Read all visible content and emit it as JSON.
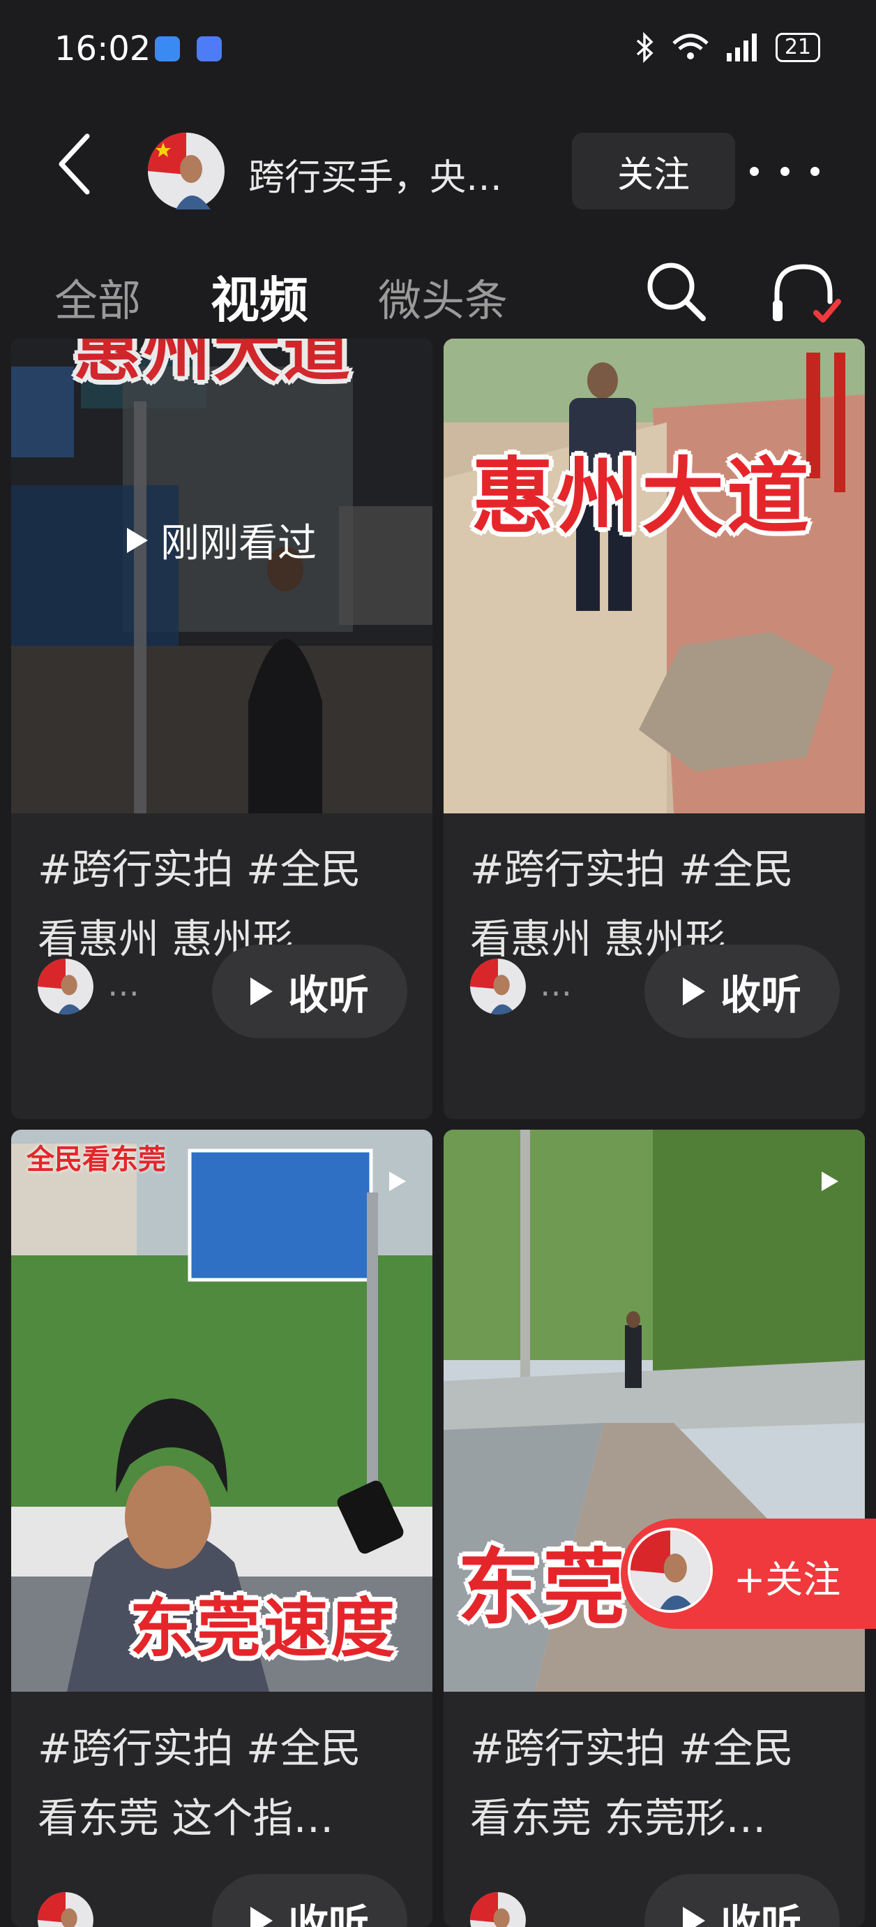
{
  "status_bar": {
    "time": "16:02",
    "battery": "21",
    "icons": [
      "sound-app-icon",
      "app-icon",
      "bluetooth-icon",
      "wifi-icon",
      "signal-icon",
      "battery-icon"
    ]
  },
  "header": {
    "profile_name": "跨行买手，央…",
    "follow_label": "关注"
  },
  "tabs": [
    {
      "label": "全部"
    },
    {
      "label": "视频"
    },
    {
      "label": "微头条"
    }
  ],
  "cards": [
    {
      "overlay": "惠州大道",
      "badge": "刚刚看过",
      "title_line1": "#跨行实拍 #全民",
      "title_line2": "看惠州 惠州形…",
      "author_ellipsis": "…",
      "listen_label": "收听"
    },
    {
      "overlay": "惠州大道",
      "title_line1": "#跨行实拍 #全民",
      "title_line2": "看惠州 惠州形…",
      "author_ellipsis": "…",
      "listen_label": "收听"
    },
    {
      "corner_label": "全民看东莞",
      "overlay": "东莞速度",
      "title_line1": "#跨行实拍 #全民",
      "title_line2": "看东莞 这个指…",
      "listen_label": "收听"
    },
    {
      "overlay": "东莞",
      "title_line1": "#跨行实拍 #全民",
      "title_line2": "看东莞 东莞形…",
      "listen_label": "收听"
    }
  ],
  "float_follow": {
    "label": "+关注"
  },
  "colors": {
    "background": "#1c1c1e",
    "card": "#262628",
    "accent_red": "#f0393c",
    "overlay_red": "#e4262b"
  }
}
